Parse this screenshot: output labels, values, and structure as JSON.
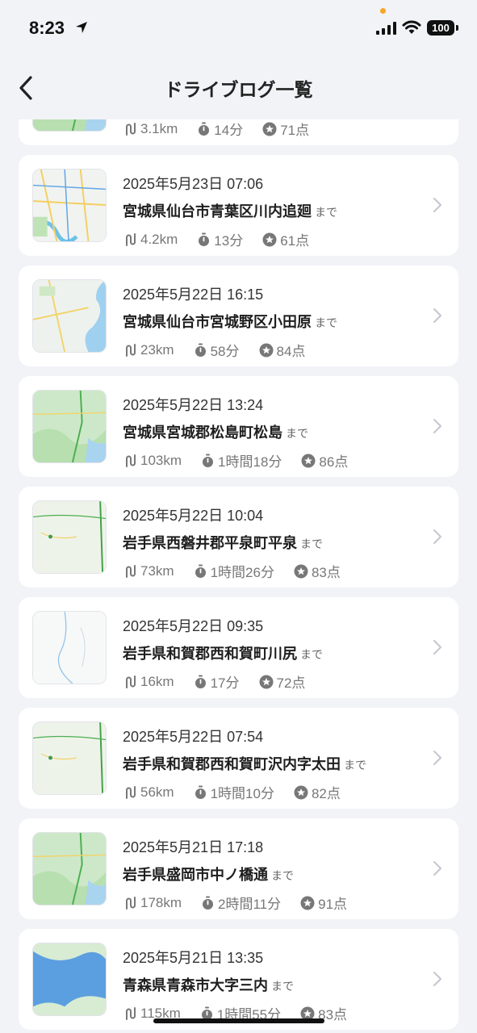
{
  "status_bar": {
    "time": "8:23",
    "battery": "100"
  },
  "nav": {
    "title": "ドライブログ一覧"
  },
  "suffix": "まで",
  "logs": [
    {
      "date": "",
      "place": "",
      "distance": "3.1km",
      "duration": "14分",
      "score": "71点",
      "map": "green"
    },
    {
      "date": "2025年5月23日 07:06",
      "place": "宮城県仙台市青葉区川内追廻",
      "distance": "4.2km",
      "duration": "13分",
      "score": "61点",
      "map": "city"
    },
    {
      "date": "2025年5月22日 16:15",
      "place": "宮城県仙台市宮城野区小田原",
      "distance": "23km",
      "duration": "58分",
      "score": "84点",
      "map": "coast"
    },
    {
      "date": "2025年5月22日 13:24",
      "place": "宮城県宮城郡松島町松島",
      "distance": "103km",
      "duration": "1時間18分",
      "score": "86点",
      "map": "green"
    },
    {
      "date": "2025年5月22日 10:04",
      "place": "岩手県西磐井郡平泉町平泉",
      "distance": "73km",
      "duration": "1時間26分",
      "score": "83点",
      "map": "rural"
    },
    {
      "date": "2025年5月22日 09:35",
      "place": "岩手県和賀郡西和賀町川尻",
      "distance": "16km",
      "duration": "17分",
      "score": "72点",
      "map": "white"
    },
    {
      "date": "2025年5月22日 07:54",
      "place": "岩手県和賀郡西和賀町沢内字太田",
      "distance": "56km",
      "duration": "1時間10分",
      "score": "82点",
      "map": "rural"
    },
    {
      "date": "2025年5月21日 17:18",
      "place": "岩手県盛岡市中ノ橋通",
      "distance": "178km",
      "duration": "2時間11分",
      "score": "91点",
      "map": "green"
    },
    {
      "date": "2025年5月21日 13:35",
      "place": "青森県青森市大字三内",
      "distance": "115km",
      "duration": "1時間55分",
      "score": "83点",
      "map": "bay"
    }
  ]
}
